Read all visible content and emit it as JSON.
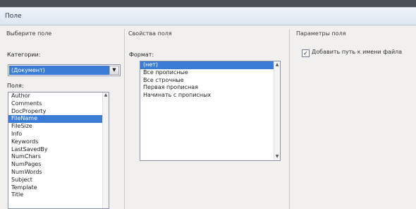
{
  "window": {
    "title": "Поле"
  },
  "left_panel": {
    "group_title": "Выберите поле",
    "category_label": "Категории:",
    "category_value": "(Документ)",
    "fields_label": "Поля:",
    "fields": [
      "Author",
      "Comments",
      "DocProperty",
      "FileName",
      "FileSize",
      "Info",
      "Keywords",
      "LastSavedBy",
      "NumChars",
      "NumPages",
      "NumWords",
      "Subject",
      "Template",
      "Title"
    ],
    "selected_field": "FileName"
  },
  "middle_panel": {
    "group_title": "Свойства поля",
    "format_label": "Формат:",
    "formats": [
      "(нет)",
      "Все прописные",
      "Все строчные",
      "Первая прописная",
      "Начинать с прописных"
    ],
    "selected_format": "(нет)"
  },
  "right_panel": {
    "group_title": "Параметры поля",
    "checkbox_label": "Добавить путь к имени файла",
    "checkbox_checked": true
  },
  "colors": {
    "selection": "#3a7bd5",
    "dialog_bg": "#f1f0ee",
    "titlebar": "#e3eaf3"
  }
}
